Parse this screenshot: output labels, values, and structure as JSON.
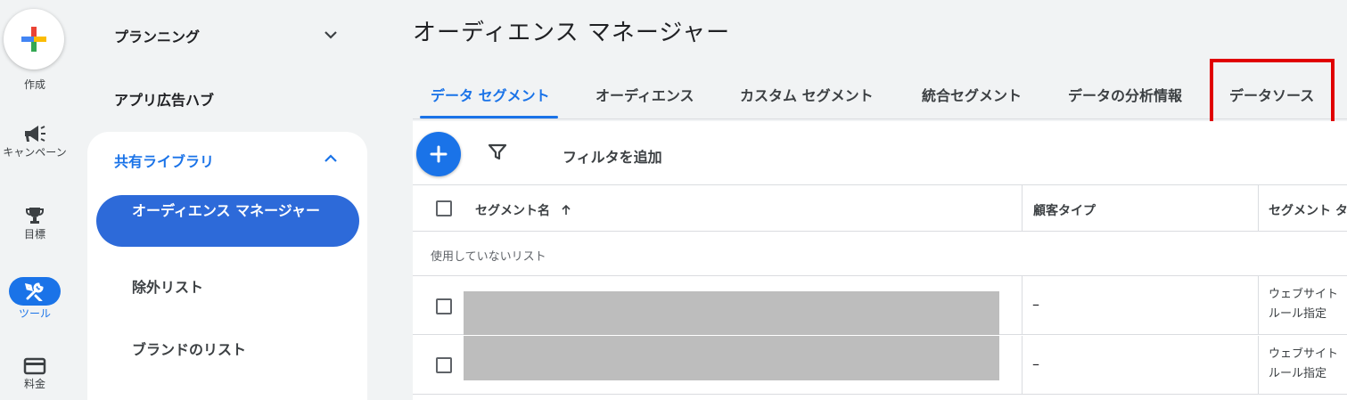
{
  "rail": {
    "create_label": "作成",
    "items": [
      {
        "label": "キャンペーン",
        "icon": "megaphone-icon"
      },
      {
        "label": "目標",
        "icon": "trophy-icon"
      },
      {
        "label": "ツール",
        "icon": "tools-icon"
      },
      {
        "label": "料金",
        "icon": "billing-card-icon"
      }
    ]
  },
  "nav": {
    "planning": "プランニング",
    "app_hub": "アプリ広告ハブ",
    "shared_library": "共有ライブラリ",
    "audience_manager": "オーディエンス マネージャー",
    "exclusion_lists": "除外リスト",
    "brand_lists": "ブランドのリスト"
  },
  "main": {
    "title": "オーディエンス マネージャー",
    "tabs": [
      "データ セグメント",
      "オーディエンス",
      "カスタム セグメント",
      "統合セグメント",
      "データの分析情報",
      "データソース"
    ],
    "active_tab": "データ セグメント",
    "highlighted_tab": "データソース",
    "highlight_color": "#e00000",
    "add_filter": "フィルタを追加",
    "columns": [
      "セグメント名",
      "顧客タイプ",
      "セグメント タ"
    ],
    "group_label": "使用していないリスト",
    "rows": [
      {
        "customer_type": "–",
        "segment_type_line1": "ウェブサイト",
        "segment_type_line2": "ルール指定"
      },
      {
        "customer_type": "–",
        "segment_type_line1": "ウェブサイト",
        "segment_type_line2": "ルール指定"
      }
    ]
  },
  "colors": {
    "accent": "#1a73e8",
    "nav_active": "#2d6ad9"
  }
}
